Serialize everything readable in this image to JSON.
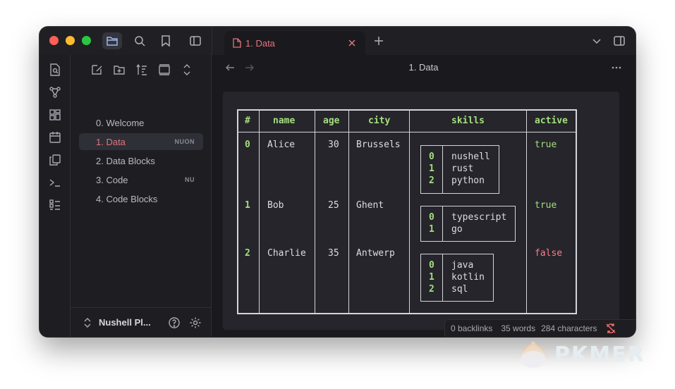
{
  "tab": {
    "label": "1. Data"
  },
  "header": {
    "title": "1. Data"
  },
  "files": [
    {
      "label": "0. Welcome",
      "badge": ""
    },
    {
      "label": "1. Data",
      "badge": "NUON"
    },
    {
      "label": "2. Data Blocks",
      "badge": ""
    },
    {
      "label": "3. Code",
      "badge": "NU"
    },
    {
      "label": "4. Code Blocks",
      "badge": ""
    }
  ],
  "vault": {
    "name": "Nushell Pl..."
  },
  "table": {
    "headers": [
      "#",
      "name",
      "age",
      "city",
      "skills",
      "active"
    ],
    "rows": [
      {
        "idx": "0",
        "name": "Alice",
        "age": "30",
        "city": "Brussels",
        "skills": [
          "nushell",
          "rust",
          "python"
        ],
        "active": "true"
      },
      {
        "idx": "1",
        "name": "Bob",
        "age": "25",
        "city": "Ghent",
        "skills": [
          "typescript",
          "go"
        ],
        "active": "true"
      },
      {
        "idx": "2",
        "name": "Charlie",
        "age": "35",
        "city": "Antwerp",
        "skills": [
          "java",
          "kotlin",
          "sql"
        ],
        "active": "false"
      }
    ],
    "sub_indices": [
      "0",
      "1",
      "2"
    ]
  },
  "status": {
    "backlinks": "0 backlinks",
    "words": "35 words",
    "characters": "284 characters"
  },
  "watermark": {
    "text": "PKMER"
  },
  "colors": {
    "accent": "#e2757f",
    "green": "#a4de7e",
    "red": "#ff7b88"
  }
}
